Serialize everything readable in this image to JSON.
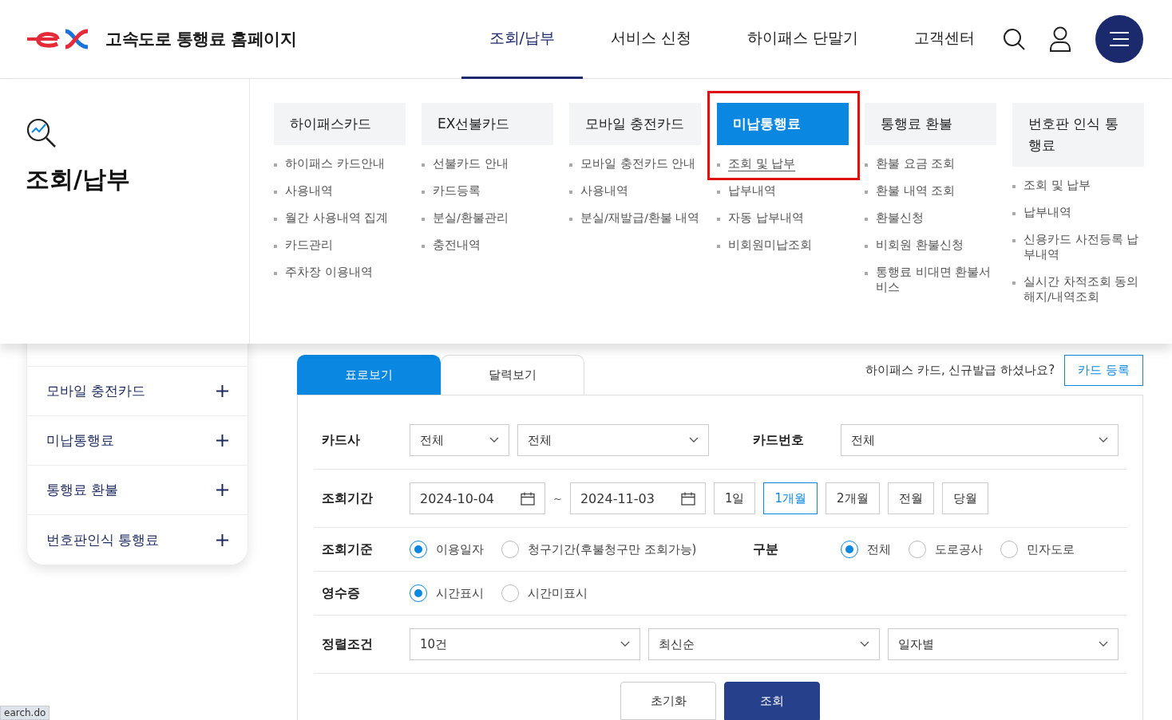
{
  "header": {
    "logo_text": "고속도로 통행료 홈페이지",
    "nav": [
      {
        "label": "조회/납부",
        "selected": true
      },
      {
        "label": "서비스 신청",
        "selected": false
      },
      {
        "label": "하이패스 단말기",
        "selected": false
      },
      {
        "label": "고객센터",
        "selected": false
      }
    ]
  },
  "mega_menu": {
    "title": "조회/납부",
    "columns": [
      {
        "title": "하이패스카드",
        "selected": false,
        "highlighted": false,
        "items": [
          {
            "label": "하이패스 카드안내",
            "selected": false
          },
          {
            "label": "사용내역",
            "selected": false
          },
          {
            "label": "월간 사용내역 집계",
            "selected": false
          },
          {
            "label": "카드관리",
            "selected": false
          },
          {
            "label": "주차장 이용내역",
            "selected": false
          }
        ]
      },
      {
        "title": "EX선불카드",
        "selected": false,
        "highlighted": false,
        "items": [
          {
            "label": "선불카드 안내",
            "selected": false
          },
          {
            "label": "카드등록",
            "selected": false
          },
          {
            "label": "분실/환불관리",
            "selected": false
          },
          {
            "label": "충전내역",
            "selected": false
          }
        ]
      },
      {
        "title": "모바일 충전카드",
        "selected": false,
        "highlighted": false,
        "items": [
          {
            "label": "모바일 충전카드 안내",
            "selected": false
          },
          {
            "label": "사용내역",
            "selected": false
          },
          {
            "label": "분실/재발급/환불 내역",
            "selected": false
          }
        ]
      },
      {
        "title": "미납통행료",
        "selected": true,
        "highlighted": true,
        "items": [
          {
            "label": "조회 및 납부",
            "selected": true
          },
          {
            "label": "납부내역",
            "selected": false
          },
          {
            "label": "자동 납부내역",
            "selected": false
          },
          {
            "label": "비회원미납조회",
            "selected": false
          }
        ]
      },
      {
        "title": "통행료 환불",
        "selected": false,
        "highlighted": false,
        "items": [
          {
            "label": "환불 요금 조회",
            "selected": false
          },
          {
            "label": "환불 내역 조회",
            "selected": false
          },
          {
            "label": "환불신청",
            "selected": false
          },
          {
            "label": "비회원 환불신청",
            "selected": false
          },
          {
            "label": "통행료 비대면 환불서비스",
            "selected": false
          }
        ]
      },
      {
        "title": "번호판 인식 통행료",
        "selected": false,
        "highlighted": false,
        "items": [
          {
            "label": "조회 및 납부",
            "selected": false
          },
          {
            "label": "납부내역",
            "selected": false
          },
          {
            "label": "신용카드 사전등록 납부내역",
            "selected": false
          },
          {
            "label": "실시간 차적조회 동의해지/내역조회",
            "selected": false
          }
        ]
      }
    ]
  },
  "sidebar": {
    "items": [
      {
        "label": "모바일 충전카드",
        "expanded": false
      },
      {
        "label": "미납통행료",
        "expanded": false
      },
      {
        "label": "통행료 환불",
        "expanded": false
      },
      {
        "label": "번호판인식 통행료",
        "expanded": false
      }
    ]
  },
  "tabs": [
    {
      "label": "표로보기",
      "selected": true
    },
    {
      "label": "달력보기",
      "selected": false
    }
  ],
  "promo": {
    "text": "하이패스 카드, 신규발급 하셨나요?",
    "button": "카드 등록"
  },
  "form": {
    "rows": [
      {
        "groups": [
          {
            "label": "카드사",
            "controls": [
              {
                "kind": "select",
                "value": "전체"
              },
              {
                "kind": "select",
                "value": "전체"
              }
            ]
          },
          {
            "label": "카드번호",
            "controls": [
              {
                "kind": "select",
                "value": "전체"
              }
            ]
          }
        ]
      },
      {
        "groups": [
          {
            "label": "조회기간",
            "controls": [
              {
                "kind": "date",
                "value": "2024-10-04"
              },
              {
                "kind": "text",
                "value": "~"
              },
              {
                "kind": "date",
                "value": "2024-11-03"
              },
              {
                "kind": "period",
                "value": "1일",
                "selected": false
              },
              {
                "kind": "period",
                "value": "1개월",
                "selected": true
              },
              {
                "kind": "period",
                "value": "2개월",
                "selected": false
              },
              {
                "kind": "period",
                "value": "전월",
                "selected": false
              },
              {
                "kind": "period",
                "value": "당월",
                "selected": false
              }
            ]
          }
        ]
      },
      {
        "groups": [
          {
            "label": "조회기준",
            "controls": [
              {
                "kind": "radio",
                "value": "이용일자",
                "selected": true
              },
              {
                "kind": "radio",
                "value": "청구기간(후불청구만 조회가능)",
                "selected": false
              }
            ]
          },
          {
            "label": "구분",
            "controls": [
              {
                "kind": "radio",
                "value": "전체",
                "selected": true
              },
              {
                "kind": "radio",
                "value": "도로공사",
                "selected": false
              },
              {
                "kind": "radio",
                "value": "민자도로",
                "selected": false
              }
            ]
          }
        ]
      },
      {
        "groups": [
          {
            "label": "영수증",
            "controls": [
              {
                "kind": "radio",
                "value": "시간표시",
                "selected": true
              },
              {
                "kind": "radio",
                "value": "시간미표시",
                "selected": false
              }
            ]
          }
        ]
      },
      {
        "groups": [
          {
            "label": "정렬조건",
            "controls": [
              {
                "kind": "select",
                "value": "10건"
              },
              {
                "kind": "select",
                "value": "최신순"
              },
              {
                "kind": "select",
                "value": "일자별"
              }
            ]
          }
        ]
      }
    ],
    "buttons": [
      {
        "label": "초기화",
        "kind": "secondary"
      },
      {
        "label": "조회",
        "kind": "primary"
      }
    ]
  },
  "status_bar": "earch.do"
}
